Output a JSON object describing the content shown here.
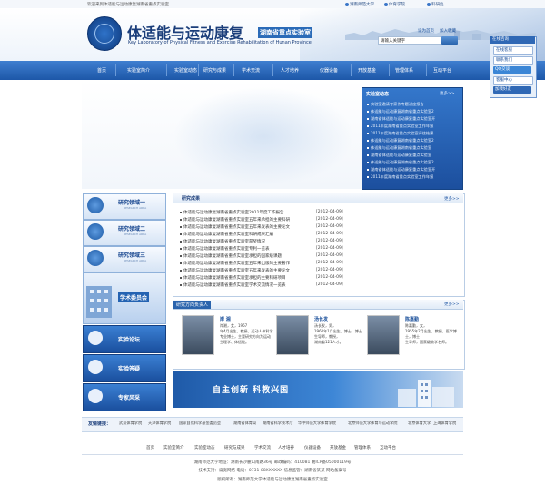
{
  "topbar": {
    "welcome": "欢迎来到体适能与运动康复湖南省重点实验室......",
    "links": [
      "湖南师范大学",
      "体育学院",
      "科研处"
    ]
  },
  "header": {
    "title_cn": "体适能与运动康复",
    "title_sub": "湖南省重点实验室",
    "title_en": "Key Laboratory of Physical Fitness and Exercise Rehabilitation of Hunan Province",
    "home_label": "设为首页",
    "fav_label": "加入收藏",
    "search_placeholder": "请输入关键字"
  },
  "nav": [
    "首页",
    "实验室简介",
    "实验室动态",
    "研究与成果",
    "学术交流",
    "人才培养",
    "仪器设备",
    "开放基金",
    "管理体系",
    "互动平台"
  ],
  "news": {
    "title": "实验室动态",
    "more": "更多>>",
    "items": [
      "实验室邀请专家作专题讲座报告",
      "体适能与运动康复湖南省重点实验室2",
      "湖南省体适能与运动康复重点实验室开",
      "2011年度湖南省重点实验室工作年报",
      "2011年度湖南省重点实验室评估结果",
      "体适能与运动康复湖南省重点实验室2",
      "体适能与运动康复湖南省重点实验室",
      "湖南省体适能与运动康复重点实验室",
      "体适能与运动康复湖南省重点实验室2",
      "湖南省体适能与运动康复重点实验室开",
      "2011年度湖南省重点实验室工作年报"
    ]
  },
  "float_widget": {
    "title": "在线咨询",
    "buttons": [
      "在线客服",
      "联系我们",
      "QQ交谈",
      "客服中心",
      "加我好友"
    ]
  },
  "left_menu": {
    "areas": [
      {
        "label": "研究领域一",
        "sub": "RESEARCH AREA"
      },
      {
        "label": "研究领域二",
        "sub": "RESEARCH AREA"
      },
      {
        "label": "研究领域三",
        "sub": "RESEARCH AREA"
      }
    ],
    "committee": "学术委员会",
    "buttons": [
      "实验论坛",
      "实验答疑",
      "专家风采"
    ]
  },
  "results": {
    "title": "研究成果",
    "more": "更多>>",
    "items": [
      {
        "text": "体适能与运动康复湖南省重点实验室2011年度工作报告",
        "date": "[2012-04-09]"
      },
      {
        "text": "体适能与运动康复湖南省重点实验室五年来承担的主要科研",
        "date": "[2012-04-09]"
      },
      {
        "text": "体适能与运动康复湖南省重点实验室五年来发表的主要论文",
        "date": "[2012-04-09]"
      },
      {
        "text": "体适能与运动康复湖南省重点实验室科研成果汇编",
        "date": "[2012-04-09]"
      },
      {
        "text": "体适能与运动康复湖南省重点实验室获奖情况",
        "date": "[2012-04-09]"
      },
      {
        "text": "体适能与运动康复湖南省重点实验室专利一览表",
        "date": "[2012-04-09]"
      },
      {
        "text": "体适能与运动康复湖南省重点实验室承担的国家级课题",
        "date": "[2012-04-09]"
      },
      {
        "text": "体适能与运动康复湖南省重点实验室五年来出版的主要著作",
        "date": "[2012-04-09]"
      },
      {
        "text": "体适能与运动康复湖南省重点实验室五年来发表的主要论文",
        "date": "[2012-04-09]"
      },
      {
        "text": "体适能与运动康复湖南省重点实验室承担的主要科研项目",
        "date": "[2012-04-09]"
      },
      {
        "text": "体适能与运动康复湖南省重点实验室学术交流情况一览表",
        "date": "[2012-04-09]"
      }
    ]
  },
  "people": {
    "title": "研究方向负责人",
    "more": "更多>>",
    "items": [
      {
        "name": "岸 湘",
        "desc": [
          "岸湘，女，1967",
          "年4月出生，教授，运动人体科学专业博士，主要研究方向为运动",
          "生理学、体适能。"
        ]
      },
      {
        "name": "汤长发",
        "desc": [
          "汤长发，男，",
          "1960年1月出生，博士，博士生导师，教授，",
          "湖南省121人才。"
        ]
      },
      {
        "name": "陈嘉勤",
        "desc": [
          "陈嘉勤，女，",
          "1955年2月出生，教授，医学博士，博士",
          "生导师，国家级教学名师。"
        ]
      }
    ]
  },
  "slogan": "自主创新    科教兴国",
  "friendly_links": {
    "title": "友情链接：",
    "items": [
      "武汉体育学院",
      "天津体育学院",
      "国家自然科学基金委员会",
      "湖南省体育局",
      "湖南省科学技术厅",
      "华中师范大学体育学院",
      "北京师范大学体育与运动学院",
      "北京体育大学",
      "上海体育学院"
    ]
  },
  "footer": {
    "nav": [
      "首页",
      "实验室简介",
      "实验室动态",
      "研究与成果",
      "学术交流",
      "人才培养",
      "仪器设备",
      "开放基金",
      "管理体系",
      "互动平台"
    ],
    "line1": "湖南师范大学地址：湖南长沙麓山南路36号  邮政编码：410081  湘ICP备05000119号",
    "line2": "技术支持：扁宽网络  电话：0731-88XXXXXX  信息监管：湖南省某某  网站备案号",
    "line3": "版权所有：湖南师范大学体适能与运动康复湖南省重点实验室"
  }
}
